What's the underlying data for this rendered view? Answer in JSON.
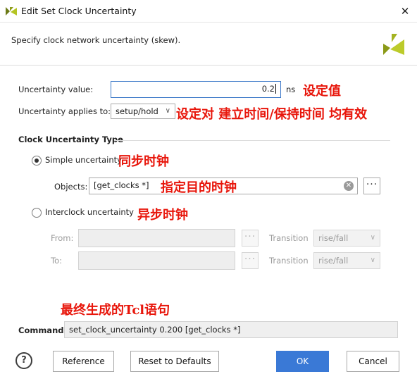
{
  "window": {
    "title": "Edit Set Clock Uncertainty",
    "close_glyph": "✕"
  },
  "header": {
    "description": "Specify clock network uncertainty (skew).",
    "logo_icon": "vivado-logo-icon"
  },
  "uncertainty_value": {
    "label": "Uncertainty value:",
    "value": "0.2",
    "unit": "ns",
    "annotation": "设定值"
  },
  "applies_to": {
    "label": "Uncertainty applies to:",
    "selected": "setup/hold",
    "annotation": "设定对 建立时间/保持时间 均有效"
  },
  "clock_type": {
    "section_title": "Clock Uncertainty Type",
    "simple": {
      "label": "Simple uncertainty",
      "selected": true,
      "annotation": "同步时钟"
    },
    "objects": {
      "label": "Objects:",
      "value": "[get_clocks *]",
      "annotation": "指定目的时钟"
    },
    "interclock": {
      "label": "Interclock uncertainty",
      "selected": false,
      "annotation": "异步时钟"
    },
    "from": {
      "label": "From:",
      "value": "",
      "transition_label": "Transition",
      "transition_value": "rise/fall"
    },
    "to": {
      "label": "To:",
      "value": "",
      "transition_label": "Transition",
      "transition_value": "rise/fall"
    }
  },
  "final_annotation": "最终生成的Tcl语句",
  "command": {
    "label": "Command:",
    "value": "set_clock_uncertainty 0.200 [get_clocks *]"
  },
  "buttons": {
    "help": "?",
    "reference": "Reference",
    "reset": "Reset to Defaults",
    "ok": "OK",
    "cancel": "Cancel"
  },
  "colors": {
    "accent": "#3a79d6",
    "annotation": "#e8160b",
    "logo": "#9aaa1e"
  }
}
